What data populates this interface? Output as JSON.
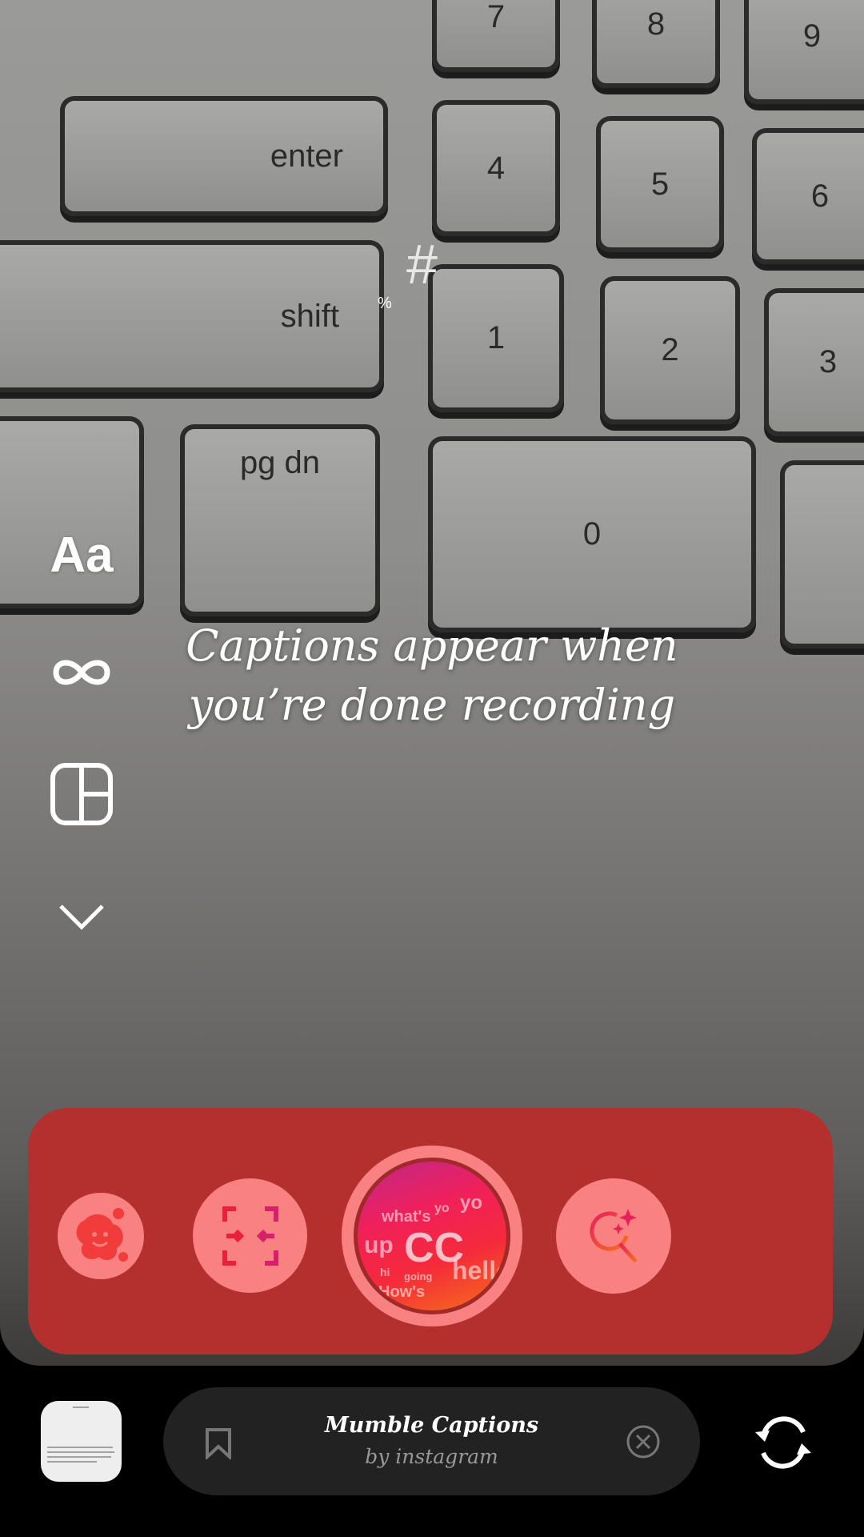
{
  "camera_scene": {
    "keys": [
      "enter",
      "shift",
      "pg dn",
      "4",
      "5",
      "6",
      "7",
      "8",
      "9",
      "1",
      "2",
      "3",
      "0",
      "#",
      "%"
    ]
  },
  "side_tools": [
    {
      "icon": "text-style-icon",
      "label": "Aa"
    },
    {
      "icon": "infinity-icon"
    },
    {
      "icon": "layout-icon"
    },
    {
      "icon": "chevron-down-icon"
    }
  ],
  "caption_hint": {
    "line1": "Captions appear when",
    "line2": "you’re done recording"
  },
  "effects_tray": {
    "items": [
      {
        "icon": "smiley-blob-effect-icon"
      },
      {
        "icon": "face-capture-effect-icon"
      },
      {
        "icon": "mumble-captions-effect",
        "center": "CC",
        "words": [
          "what's",
          "yo",
          "yo",
          "up",
          "hello",
          "hi",
          "going",
          "How's"
        ]
      },
      {
        "icon": "search-effects-icon"
      }
    ]
  },
  "effect_info": {
    "title": "Mumble Captions",
    "author": "by instagram",
    "save_icon": "bookmark-icon",
    "close_icon": "close-circle-icon"
  },
  "flip_camera": {
    "icon": "flip-camera-icon"
  },
  "colors": {
    "tray": "#b3302f",
    "effect_button": "#f98181",
    "pill": "#222222"
  }
}
